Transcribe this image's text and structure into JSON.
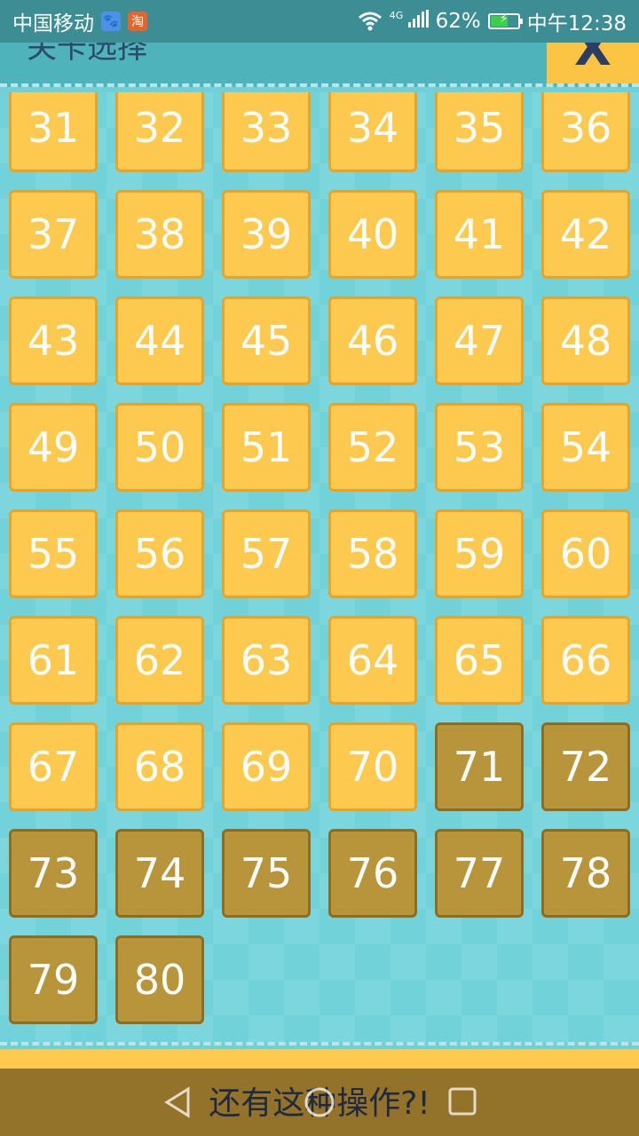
{
  "status_bar": {
    "carrier": "中国移动",
    "app_badge_1": "🐾",
    "app_badge_2": "淘",
    "network": "4G",
    "battery_percent": "62%",
    "battery_level": 0.62,
    "time": "中午12:38"
  },
  "header": {
    "title": "关卡选择",
    "close_label": "X"
  },
  "levels": [
    {
      "n": "31",
      "locked": false
    },
    {
      "n": "32",
      "locked": false
    },
    {
      "n": "33",
      "locked": false
    },
    {
      "n": "34",
      "locked": false
    },
    {
      "n": "35",
      "locked": false
    },
    {
      "n": "36",
      "locked": false
    },
    {
      "n": "37",
      "locked": false
    },
    {
      "n": "38",
      "locked": false
    },
    {
      "n": "39",
      "locked": false
    },
    {
      "n": "40",
      "locked": false
    },
    {
      "n": "41",
      "locked": false
    },
    {
      "n": "42",
      "locked": false
    },
    {
      "n": "43",
      "locked": false
    },
    {
      "n": "44",
      "locked": false
    },
    {
      "n": "45",
      "locked": false
    },
    {
      "n": "46",
      "locked": false
    },
    {
      "n": "47",
      "locked": false
    },
    {
      "n": "48",
      "locked": false
    },
    {
      "n": "49",
      "locked": false
    },
    {
      "n": "50",
      "locked": false
    },
    {
      "n": "51",
      "locked": false
    },
    {
      "n": "52",
      "locked": false
    },
    {
      "n": "53",
      "locked": false
    },
    {
      "n": "54",
      "locked": false
    },
    {
      "n": "55",
      "locked": false
    },
    {
      "n": "56",
      "locked": false
    },
    {
      "n": "57",
      "locked": false
    },
    {
      "n": "58",
      "locked": false
    },
    {
      "n": "59",
      "locked": false
    },
    {
      "n": "60",
      "locked": false
    },
    {
      "n": "61",
      "locked": false
    },
    {
      "n": "62",
      "locked": false
    },
    {
      "n": "63",
      "locked": false
    },
    {
      "n": "64",
      "locked": false
    },
    {
      "n": "65",
      "locked": false
    },
    {
      "n": "66",
      "locked": false
    },
    {
      "n": "67",
      "locked": false
    },
    {
      "n": "68",
      "locked": false
    },
    {
      "n": "69",
      "locked": false
    },
    {
      "n": "70",
      "locked": false
    },
    {
      "n": "71",
      "locked": true
    },
    {
      "n": "72",
      "locked": true
    },
    {
      "n": "73",
      "locked": true
    },
    {
      "n": "74",
      "locked": true
    },
    {
      "n": "75",
      "locked": true
    },
    {
      "n": "76",
      "locked": true
    },
    {
      "n": "77",
      "locked": true
    },
    {
      "n": "78",
      "locked": true
    },
    {
      "n": "79",
      "locked": true
    },
    {
      "n": "80",
      "locked": true
    }
  ],
  "bottom": {
    "message": "还有这种操作?!"
  },
  "colors": {
    "unlocked_tile": "#fdc94e",
    "locked_tile": "#b8953a",
    "background": "#6fd0d8",
    "close_button": "#fbc443"
  }
}
